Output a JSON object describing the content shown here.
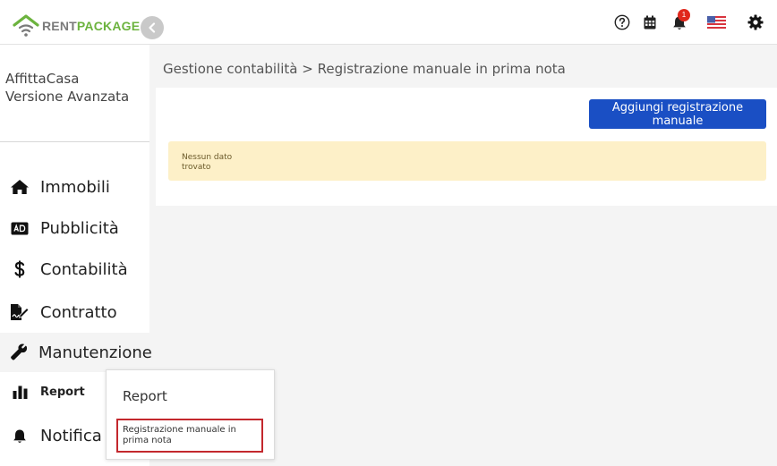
{
  "app": {
    "logo": {
      "part1": "RENT",
      "part2": "PACKAGE"
    },
    "brand_green": "#6cb33e",
    "brand_grey": "#7a7a7a"
  },
  "header": {
    "icons": [
      "help-icon",
      "calendar-icon",
      "bell-icon",
      "us-flag-icon",
      "gear-icon"
    ],
    "notification_count": "1"
  },
  "sidebar": {
    "company_name": "AffittaCasa",
    "company_plan": "Versione Avanzata",
    "items": [
      {
        "label": "Immobili",
        "icon": "home-icon"
      },
      {
        "label": "Pubblicità",
        "icon": "ad-icon"
      },
      {
        "label": "Contabilità",
        "icon": "dollar-icon"
      },
      {
        "label": "Contratto",
        "icon": "contract-icon"
      },
      {
        "label": "Manutenzione",
        "icon": "wrench-icon"
      },
      {
        "label": "Report",
        "icon": "bar-chart-icon"
      },
      {
        "label": "Notifica",
        "icon": "bell-icon"
      }
    ]
  },
  "main": {
    "breadcrumb": "Gestione contabilità > Registrazione manuale in prima nota",
    "add_button_label": "Aggiungi registrazione manuale",
    "empty_message": "Nessun dato trovato",
    "accent": "#1a4fc4",
    "alert_bg": "#fdf0c8"
  },
  "submenu": {
    "title": "Report",
    "item": "Registrazione manuale in prima nota",
    "highlight": "#c3282d"
  }
}
